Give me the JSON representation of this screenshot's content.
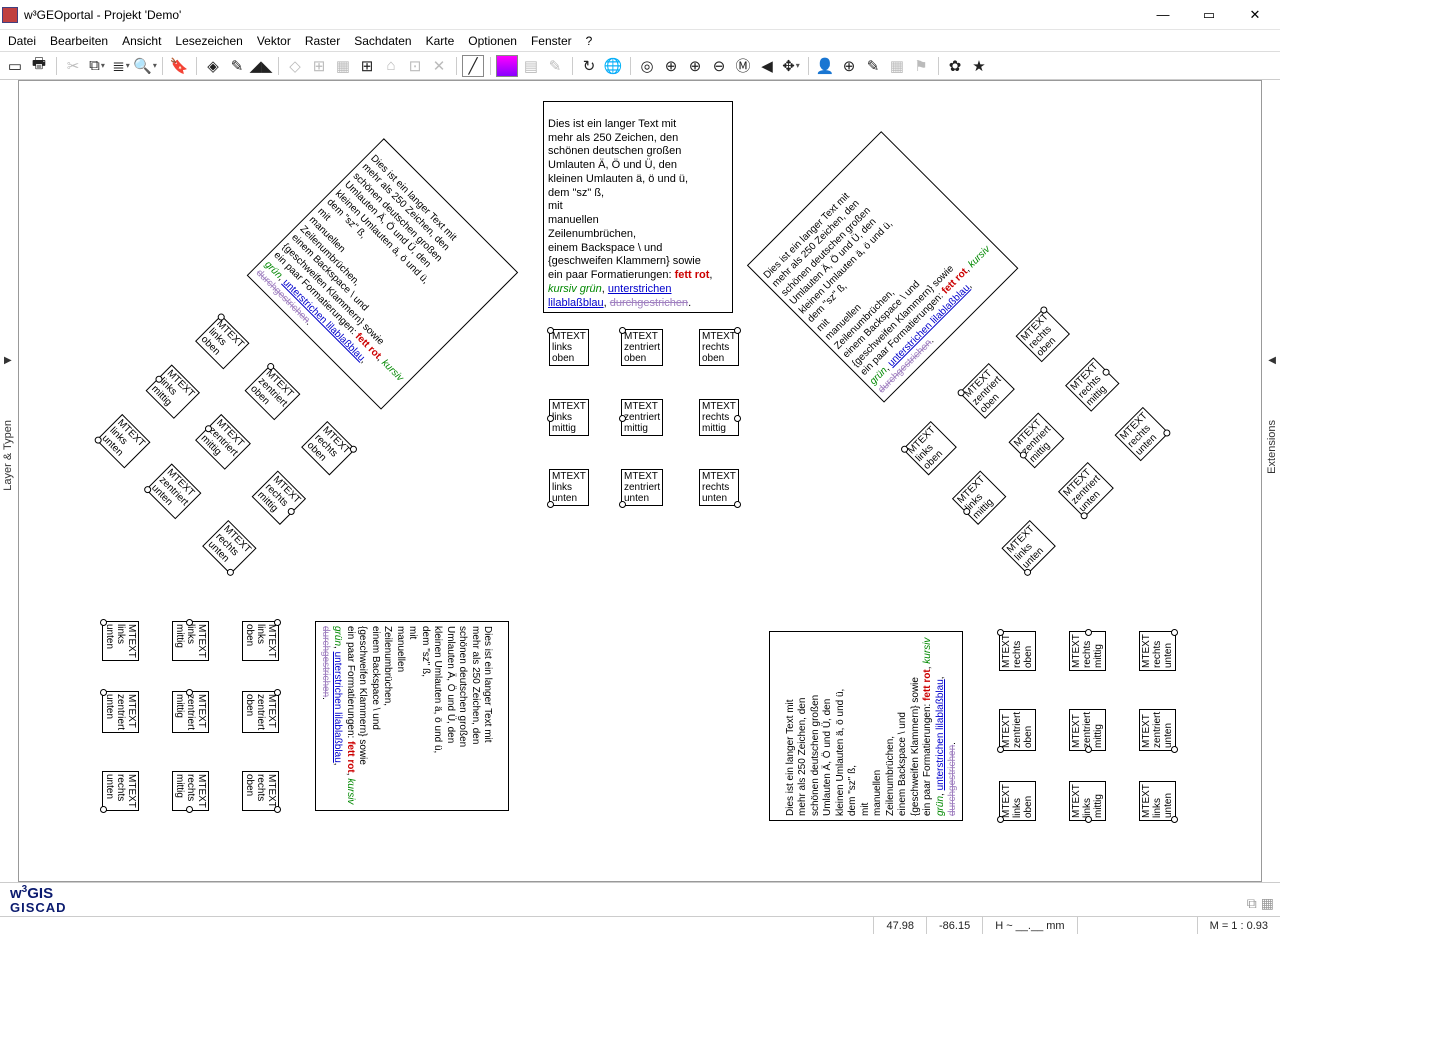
{
  "window": {
    "title": "w³GEOportal - Projekt 'Demo'",
    "min": "—",
    "max": "▭",
    "close": "✕"
  },
  "menu": [
    "Datei",
    "Bearbeiten",
    "Ansicht",
    "Lesezeichen",
    "Vektor",
    "Raster",
    "Sachdaten",
    "Karte",
    "Optionen",
    "Fenster",
    "?"
  ],
  "side_left": "Layer & Typen",
  "side_right": "Extensions",
  "paragraph": {
    "plain": "Dies ist ein langer Text mit\nmehr als 250 Zeichen, den\nschönen deutschen großen\nUmlauten Ä, Ö und Ü, den\nkleinen Umlauten ä, ö und ü,\ndem \"sz\" ß,\nmit\nmanuellen\nZeilenumbrüchen,\neinem Backspace \\ und\n{geschweifen Klammern} sowie\nein paar Formatierungen: ",
    "red": "fett rot",
    "sep1": ", ",
    "green": "kursiv grün",
    "sep2": ", ",
    "blue": "unterstrichen lilablaßblau",
    "sep3": ", ",
    "lila": "durchgestrichen",
    "end": "."
  },
  "mtext": {
    "links_oben": "MTEXT\nlinks\noben",
    "zentriert_oben": "MTEXT\nzentriert\noben",
    "rechts_oben": "MTEXT\nrechts\noben",
    "links_mittig": "MTEXT\nlinks\nmittig",
    "zentriert_mittig": "MTEXT\nzentriert\nmittig",
    "rechts_mittig": "MTEXT\nrechts\nmittig",
    "links_unten": "MTEXT\nlinks\nunten",
    "zentriert_unten": "MTEXT\nzentriert\nunten",
    "rechts_unten": "MTEXT\nrechts\nunten"
  },
  "status": {
    "x": "47.98",
    "y": "-86.15",
    "h": "H ~ __.__  mm",
    "scale": "M = 1 :  0.93"
  },
  "brand": {
    "l1a": "w",
    "l1sup": "3",
    "l1b": "GIS",
    "l2": "GISCAD"
  }
}
